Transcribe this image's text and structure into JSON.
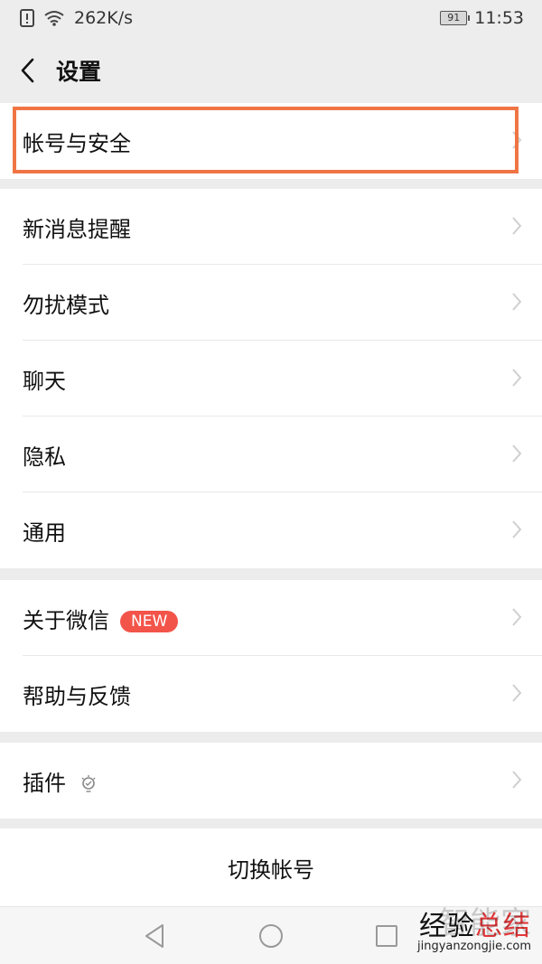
{
  "statusbar": {
    "speed": "262K/s",
    "battery": "91",
    "time": "11:53"
  },
  "header": {
    "title": "设置"
  },
  "groups": [
    {
      "items": [
        {
          "label": "帐号与安全"
        }
      ]
    },
    {
      "items": [
        {
          "label": "新消息提醒"
        },
        {
          "label": "勿扰模式"
        },
        {
          "label": "聊天"
        },
        {
          "label": "隐私"
        },
        {
          "label": "通用"
        }
      ]
    },
    {
      "items": [
        {
          "label": "关于微信",
          "badge": "NEW"
        },
        {
          "label": "帮助与反馈"
        }
      ]
    },
    {
      "items": [
        {
          "label": "插件"
        }
      ]
    }
  ],
  "switch_account": "切换帐号",
  "watermark": {
    "faint": "智能家",
    "big_left": "经验",
    "big_right": "总结",
    "url": "jingyanzongjie.com"
  },
  "colors": {
    "highlight": "#f07545",
    "badge": "#f3544a"
  }
}
